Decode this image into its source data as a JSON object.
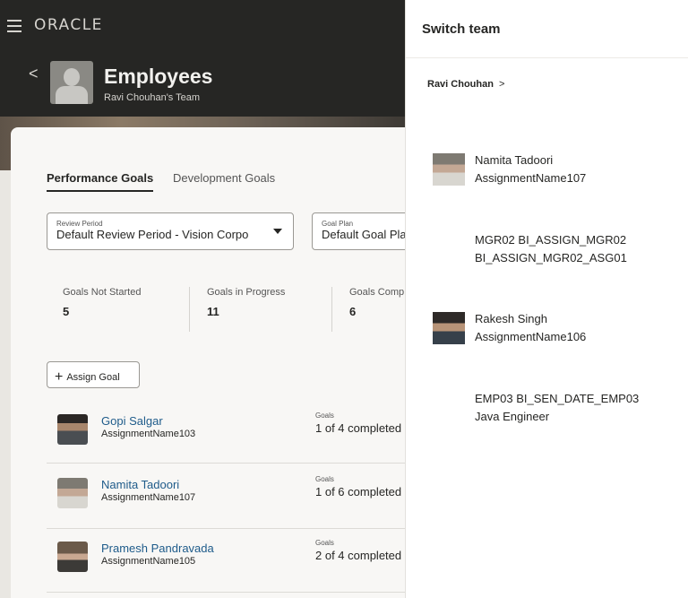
{
  "app": {
    "logo": "ORACLE",
    "back_glyph": "<",
    "title": "Employees",
    "subtitle": "Ravi Chouhan's Team",
    "tabs": [
      {
        "label": "Performance Goals",
        "active": true
      },
      {
        "label": "Development Goals",
        "active": false
      }
    ],
    "review_period": {
      "label": "Review Period",
      "value": "Default Review Period - Vision Corpo"
    },
    "goal_plan": {
      "label": "Goal Plan",
      "value": "Default Goal Pla"
    },
    "stats": [
      {
        "label": "Goals Not Started",
        "value": "5"
      },
      {
        "label": "Goals in Progress",
        "value": "11"
      },
      {
        "label": "Goals Comp",
        "value": "6"
      }
    ],
    "assign_goal": {
      "icon": "+",
      "label": "Assign Goal"
    },
    "employees": [
      {
        "name": "Gopi Salgar",
        "assignment": "AssignmentName103",
        "goals_label": "Goals",
        "goals_value": "1 of 4 completed"
      },
      {
        "name": "Namita Tadoori",
        "assignment": "AssignmentName107",
        "goals_label": "Goals",
        "goals_value": "1 of 6 completed"
      },
      {
        "name": "Pramesh Pandravada",
        "assignment": "AssignmentName105",
        "goals_label": "Goals",
        "goals_value": "2 of 4 completed"
      }
    ]
  },
  "panel": {
    "title": "Switch team",
    "breadcrumb": "Ravi Chouhan",
    "breadcrumb_chevron": ">",
    "members": [
      {
        "line1": "Namita Tadoori",
        "line2": "AssignmentName107",
        "has_photo": true
      },
      {
        "line1": "MGR02 BI_ASSIGN_MGR02",
        "line2": "BI_ASSIGN_MGR02_ASG01",
        "has_photo": false
      },
      {
        "line1": "Rakesh Singh",
        "line2": "AssignmentName106",
        "has_photo": true
      },
      {
        "line1": "EMP03 BI_SEN_DATE_EMP03",
        "line2": "Java Engineer",
        "has_photo": false
      }
    ]
  },
  "colors": {
    "header_bg": "#262624",
    "link": "#1e5b8a",
    "panel_bg": "#ffffff"
  }
}
